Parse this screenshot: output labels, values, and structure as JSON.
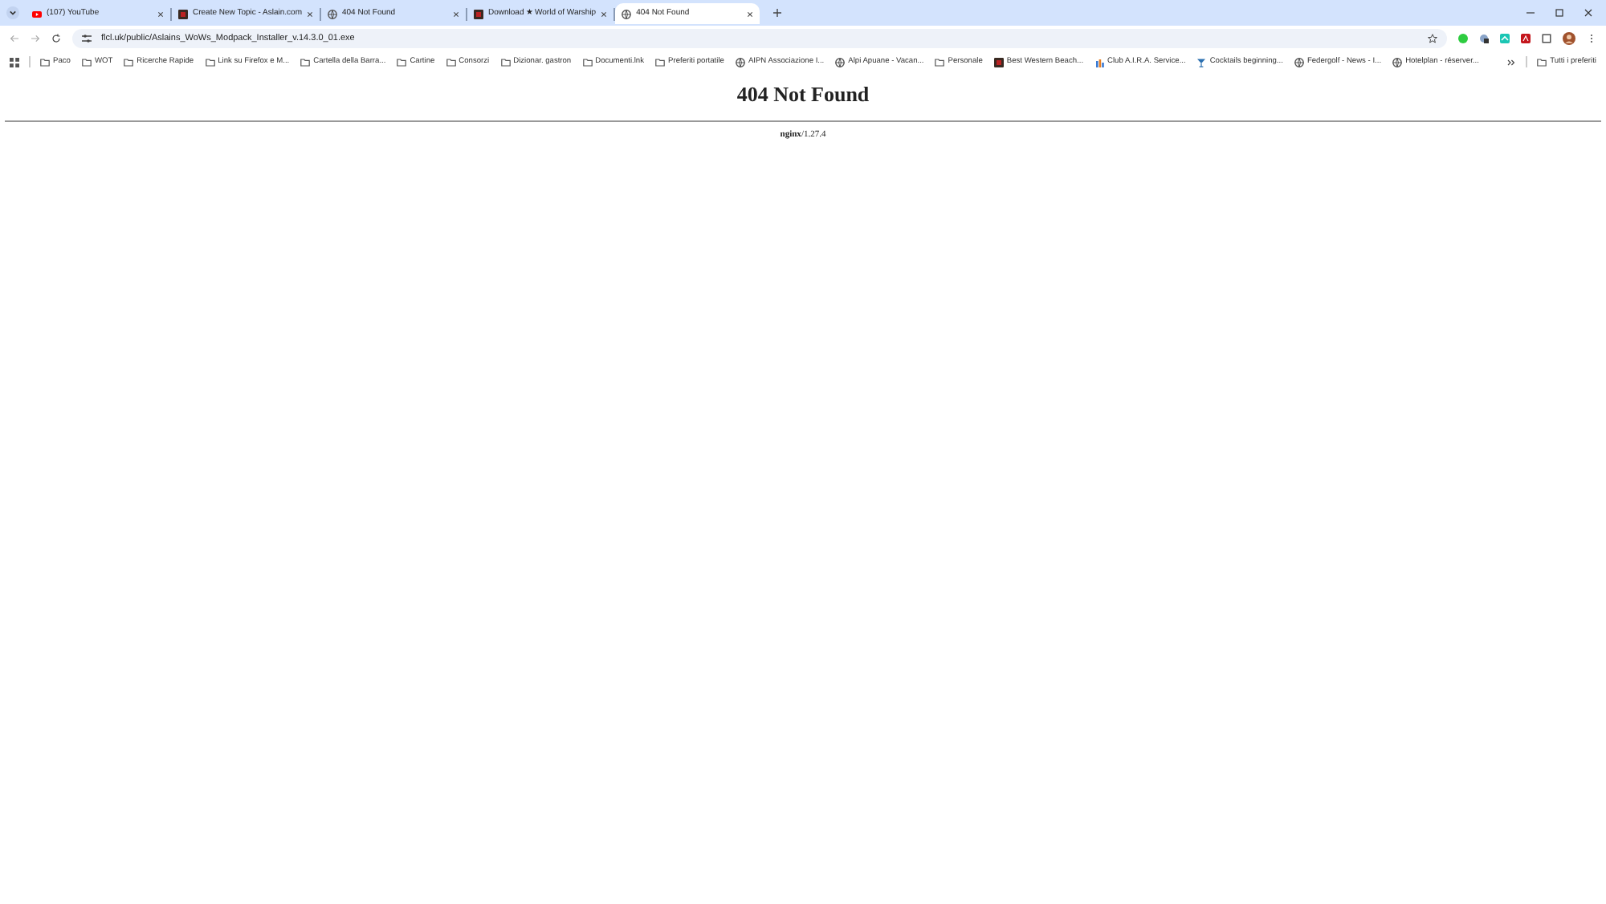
{
  "tabs": [
    {
      "title": "(107) YouTube",
      "kind": "video",
      "selected": false
    },
    {
      "title": "Create New Topic - Aslain.com",
      "kind": "site",
      "selected": false
    },
    {
      "title": "404 Not Found",
      "kind": "globe",
      "selected": false
    },
    {
      "title": "Download ★ World of Warship",
      "kind": "site",
      "selected": false
    },
    {
      "title": "404 Not Found",
      "kind": "globe",
      "selected": true
    }
  ],
  "address": "flcl.uk/public/Aslains_WoWs_Modpack_Installer_v.14.3.0_01.exe",
  "bookmarks": [
    {
      "label": "Paco",
      "kind": "folder"
    },
    {
      "label": "WOT",
      "kind": "folder"
    },
    {
      "label": "Ricerche Rapide",
      "kind": "folder"
    },
    {
      "label": "Link su Firefox e M...",
      "kind": "folder"
    },
    {
      "label": "Cartella della Barra...",
      "kind": "folder"
    },
    {
      "label": "Cartine",
      "kind": "folder"
    },
    {
      "label": "Consorzi",
      "kind": "folder"
    },
    {
      "label": "Dizionar. gastron",
      "kind": "folder"
    },
    {
      "label": "Documenti.lnk",
      "kind": "folder"
    },
    {
      "label": "Preferiti portatile",
      "kind": "folder"
    },
    {
      "label": "AIPN Associazione I...",
      "kind": "globe"
    },
    {
      "label": "Alpi Apuane - Vacan...",
      "kind": "globe"
    },
    {
      "label": "Personale",
      "kind": "folder"
    },
    {
      "label": "Best Western Beach...",
      "kind": "site"
    },
    {
      "label": "Club A.I.R.A. Service...",
      "kind": "chart"
    },
    {
      "label": "Cocktails beginning...",
      "kind": "cocktail"
    },
    {
      "label": "Federgolf - News - I...",
      "kind": "globe"
    },
    {
      "label": "Hotelplan - réserver...",
      "kind": "globe"
    }
  ],
  "other_bookmarks": "Tutti i preferiti",
  "page": {
    "heading": "404 Not Found",
    "footer": "**nginx**/1.27.4"
  }
}
